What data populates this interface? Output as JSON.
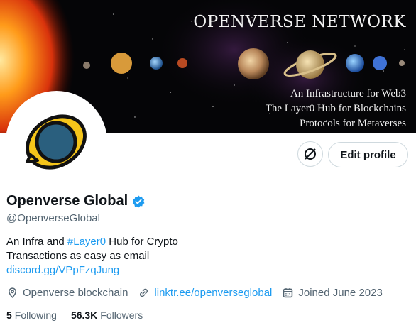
{
  "banner": {
    "title": "OPENVERSE NETWORK",
    "lines": [
      "An Infrastructure for Web3",
      "The Layer0 Hub for Blockchains",
      "Protocols for Metaverses"
    ]
  },
  "actions": {
    "edit_profile_label": "Edit profile"
  },
  "profile": {
    "display_name": "Openverse Global",
    "handle": "@OpenverseGlobal",
    "bio": {
      "line1_prefix": "An Infra and ",
      "hashtag": "#Layer0",
      "line1_suffix": " Hub for Crypto",
      "line2": "Transactions as easy as email",
      "link": "discord.gg/VPpFzqJung"
    },
    "location": "Openverse blockchain",
    "website": "linktr.ee/openverseglobal",
    "joined": "Joined June 2023",
    "following_count": "5",
    "following_label": "Following",
    "followers_count": "56.3K",
    "followers_label": "Followers"
  },
  "colors": {
    "accent": "#1d9bf0",
    "text_primary": "#0f1419",
    "text_secondary": "#536471",
    "border": "#cfd9de"
  },
  "icons": {
    "verified": "verified-badge-icon",
    "location": "location-pin-icon",
    "website": "link-icon",
    "joined": "calendar-icon",
    "follow_action": "unfollow-circle-icon"
  }
}
